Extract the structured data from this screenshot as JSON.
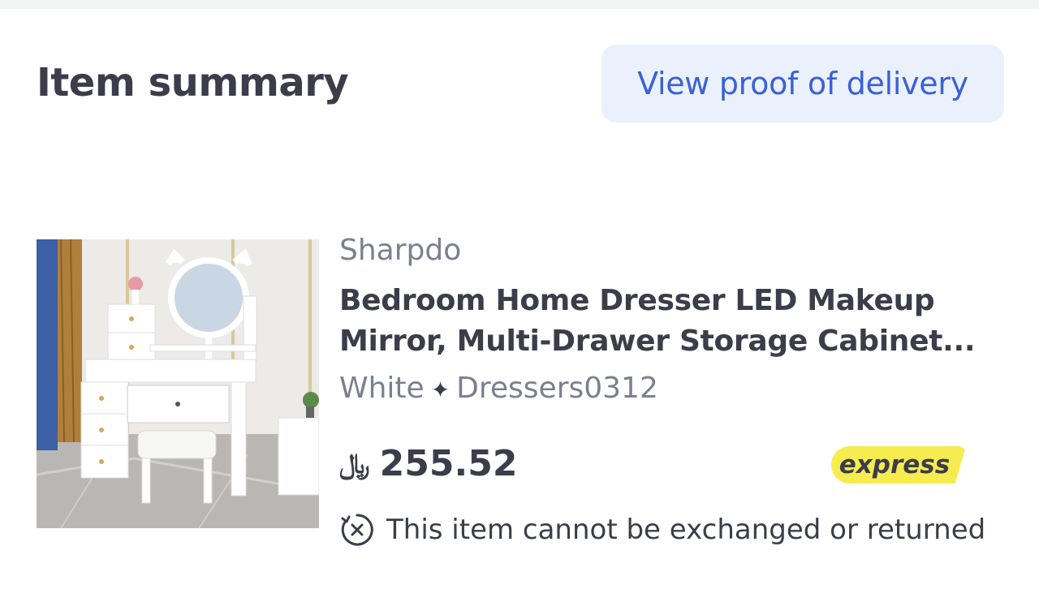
{
  "header": {
    "title": "Item summary",
    "proof_button_label": "View proof of delivery"
  },
  "item": {
    "image_icon": "product-photo",
    "brand": "Sharpdo",
    "name_line1": "Bedroom Home Dresser LED Makeup",
    "name_line2": "Mirror, Multi-Drawer Storage Cabinet...",
    "variant_color": "White",
    "variant_separator": "✦",
    "variant_model": "Dressers0312",
    "currency_symbol": "﷼",
    "price": "255.52",
    "badge": "express",
    "return_policy": "This item cannot be exchanged or returned"
  },
  "colors": {
    "accent_blue": "#3b61d6",
    "button_bg": "#ebf1fc",
    "express_yellow": "#f7ec4f",
    "text_primary": "#3b3d4a",
    "text_secondary": "#7b7f91"
  }
}
